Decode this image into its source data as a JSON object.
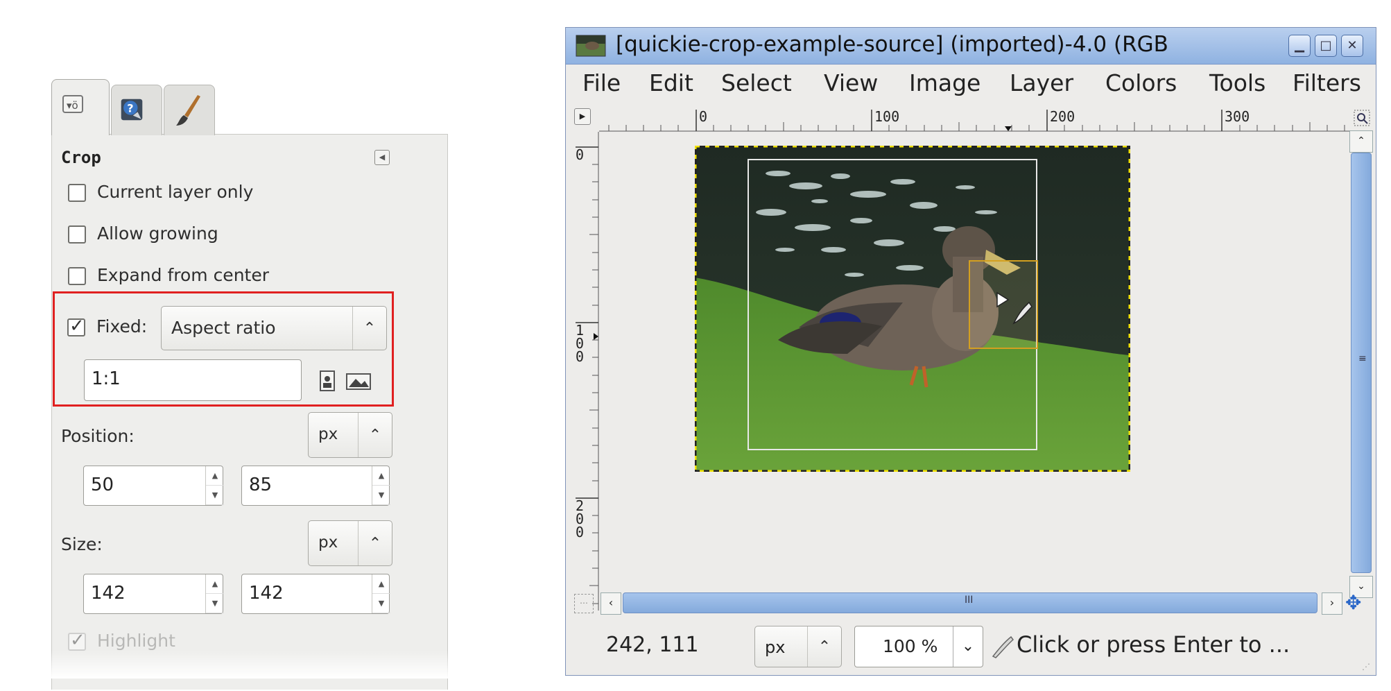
{
  "tool_options": {
    "tabs": [
      "tool-options",
      "help-browser",
      "paint-brush"
    ],
    "section_title": "Crop",
    "current_layer_only": {
      "label": "Current layer only",
      "checked": false
    },
    "allow_growing": {
      "label": "Allow growing",
      "checked": false
    },
    "expand_from_center": {
      "label": "Expand from center",
      "checked": false
    },
    "fixed": {
      "label": "Fixed:",
      "checked": true,
      "mode": "Aspect ratio",
      "ratio": "1:1"
    },
    "position": {
      "label": "Position:",
      "unit": "px",
      "x": "50",
      "y": "85"
    },
    "size": {
      "label": "Size:",
      "unit": "px",
      "w": "142",
      "h": "142"
    },
    "highlight": {
      "label": "Highlight",
      "checked": true
    }
  },
  "image_window": {
    "title": "[quickie-crop-example-source] (imported)-4.0 (RGB",
    "menu": [
      "File",
      "Edit",
      "Select",
      "View",
      "Image",
      "Layer",
      "Colors",
      "Tools",
      "Filters"
    ],
    "ruler_h_labels": [
      "0",
      "100",
      "200",
      "300"
    ],
    "ruler_v_labels": [
      "0",
      "100",
      "200"
    ],
    "status": {
      "coords": "242, 111",
      "unit": "px",
      "zoom": "100 %",
      "message": "Click or press Enter to ..."
    }
  },
  "colors": {
    "highlight_box": "#e02020",
    "title_bar": "#9bbbe6",
    "scrollbar": "#8fb3e2"
  }
}
